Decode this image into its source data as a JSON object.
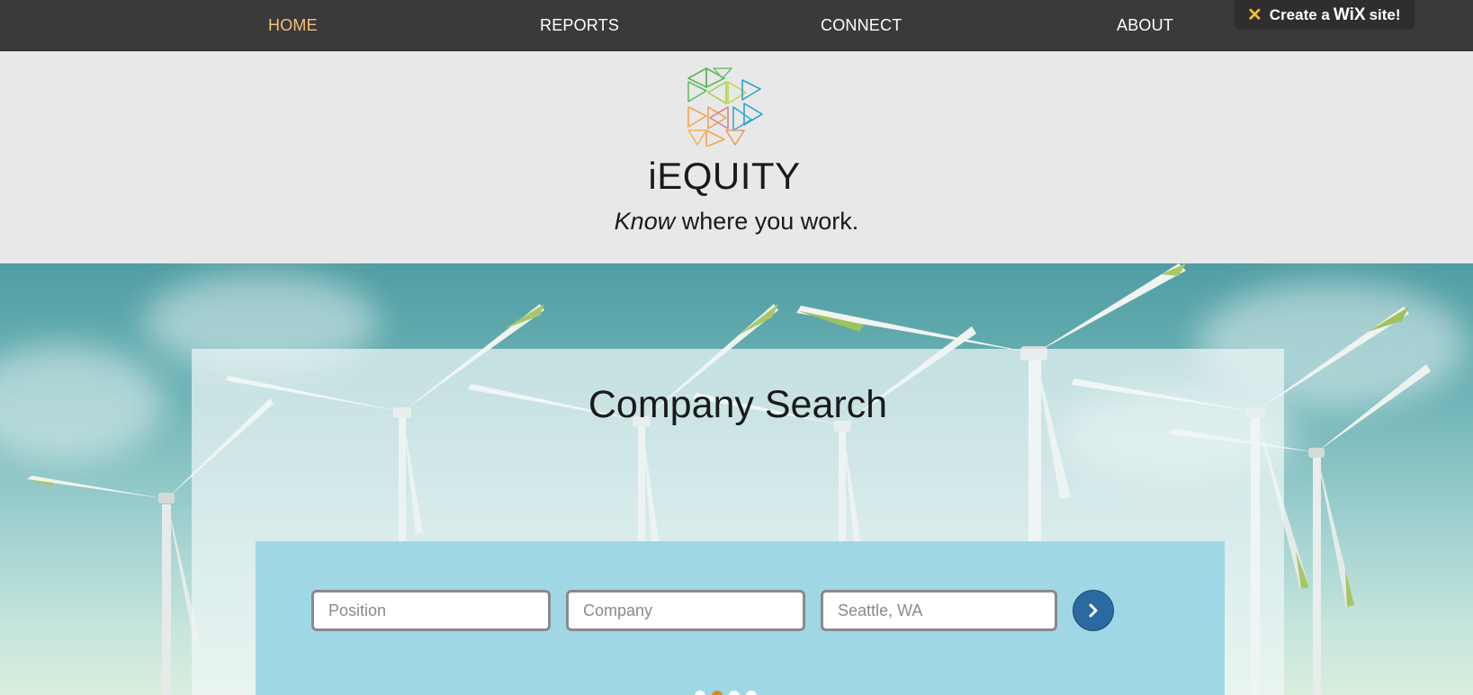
{
  "nav": {
    "items": [
      {
        "label": "HOME"
      },
      {
        "label": "REPORTS"
      },
      {
        "label": "CONNECT"
      },
      {
        "label": "ABOUT"
      }
    ],
    "active_color": "#f4c27a",
    "background": "#3a3a3a"
  },
  "wix_badge": {
    "prefix": "Create a",
    "brand": "WiX",
    "suffix": "site!"
  },
  "header": {
    "brand": "iEQUITY",
    "tagline_emphasis": "Know",
    "tagline_rest": " where you work."
  },
  "search": {
    "title": "Company Search",
    "position_placeholder": "Position",
    "company_placeholder": "Company",
    "location_placeholder": "Seattle, WA",
    "submit_icon": "chevron-right-icon",
    "panel_color": "#9fd8e4",
    "button_color": "#2b6aa0"
  },
  "slideshow": {
    "slide_count": 4,
    "active_index": 1,
    "active_color": "#e08a1e"
  }
}
